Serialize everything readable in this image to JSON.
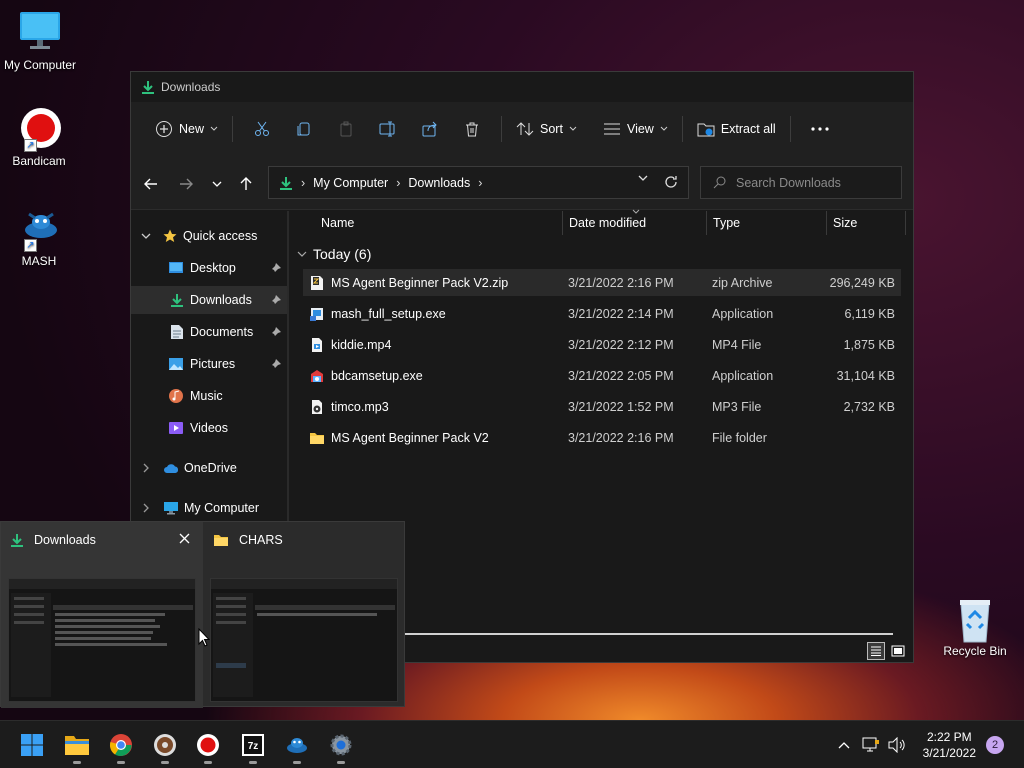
{
  "desktop": {
    "icons": [
      {
        "label": "My Computer"
      },
      {
        "label": "Bandicam"
      },
      {
        "label": "MASH"
      },
      {
        "label": "Recycle Bin"
      }
    ]
  },
  "window": {
    "title": "Downloads",
    "toolbar": {
      "new_label": "New",
      "sort_label": "Sort",
      "view_label": "View",
      "extract_label": "Extract all"
    },
    "address": {
      "crumbs": [
        "My Computer",
        "Downloads"
      ]
    },
    "search": {
      "placeholder": "Search Downloads"
    },
    "nav": {
      "quick_access": "Quick access",
      "items": [
        {
          "label": "Desktop",
          "pinned": true
        },
        {
          "label": "Downloads",
          "pinned": true,
          "selected": true
        },
        {
          "label": "Documents",
          "pinned": true
        },
        {
          "label": "Pictures",
          "pinned": true
        },
        {
          "label": "Music",
          "pinned": false
        },
        {
          "label": "Videos",
          "pinned": false
        }
      ],
      "onedrive": "OneDrive",
      "my_computer": "My Computer"
    },
    "columns": {
      "name": "Name",
      "date": "Date modified",
      "type": "Type",
      "size": "Size"
    },
    "group": "Today (6)",
    "files": [
      {
        "name": "MS Agent Beginner Pack V2.zip",
        "date": "3/21/2022 2:16 PM",
        "type": "zip Archive",
        "size": "296,249 KB",
        "icon": "zip-icon"
      },
      {
        "name": "mash_full_setup.exe",
        "date": "3/21/2022 2:14 PM",
        "type": "Application",
        "size": "6,119 KB",
        "icon": "installer-icon"
      },
      {
        "name": "kiddie.mp4",
        "date": "3/21/2022 2:12 PM",
        "type": "MP4 File",
        "size": "1,875 KB",
        "icon": "video-file-icon"
      },
      {
        "name": "bdcamsetup.exe",
        "date": "3/21/2022 2:05 PM",
        "type": "Application",
        "size": "31,104 KB",
        "icon": "setup-icon"
      },
      {
        "name": "timco.mp3",
        "date": "3/21/2022 1:52 PM",
        "type": "MP3 File",
        "size": "2,732 KB",
        "icon": "audio-file-icon"
      },
      {
        "name": "MS Agent Beginner Pack V2",
        "date": "3/21/2022 2:16 PM",
        "type": "File folder",
        "size": "",
        "icon": "folder-icon"
      }
    ]
  },
  "preview": {
    "windows": [
      {
        "title": "Downloads"
      },
      {
        "title": "CHARS"
      }
    ]
  },
  "taskbar": {
    "time": "2:22 PM",
    "date": "3/21/2022",
    "notifications": "2"
  }
}
